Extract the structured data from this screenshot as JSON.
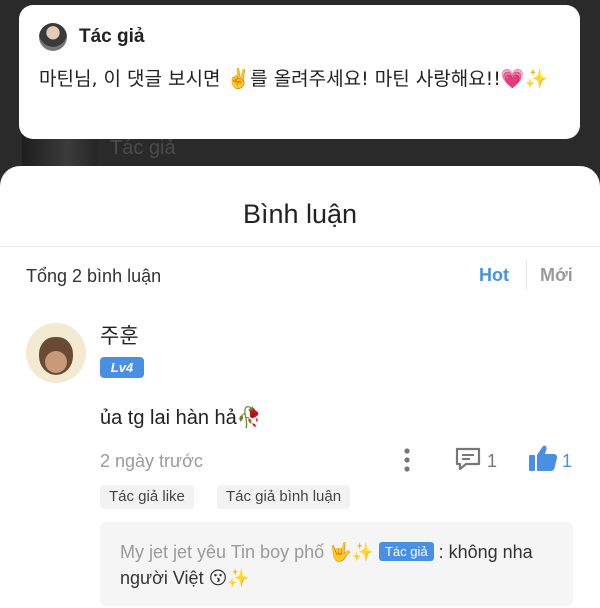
{
  "author_card": {
    "name": "Tác giả",
    "message": "마틴님, 이 댓글 보시면 ✌️를 올려주세요! 마틴 사랑해요!!💗✨"
  },
  "background": {
    "faded_label": "Tác giả"
  },
  "sheet": {
    "title": "Bình luận",
    "total": "Tổng 2 bình luận",
    "sort_hot": "Hot",
    "sort_new": "Mới"
  },
  "comment": {
    "username": "주훈",
    "level": "Lv4",
    "text": "ủa tg lai hàn hả🥀",
    "time": "2 ngày trước",
    "reply_count": "1",
    "like_count": "1",
    "tags": [
      "Tác giả like",
      "Tác giả bình luận"
    ],
    "reply": {
      "username": "My jet jet yêu Tin boy phố 🤟✨",
      "badge": "Tác giả",
      "text": ": không nha người Việt 😗✨"
    }
  },
  "colors": {
    "accent": "#4a90e2",
    "muted": "#9a9a9a",
    "backdrop": "#2a2a2a"
  },
  "icons": {
    "more": "more-vertical-icon",
    "reply": "comment-icon",
    "like": "thumbs-up-icon"
  }
}
